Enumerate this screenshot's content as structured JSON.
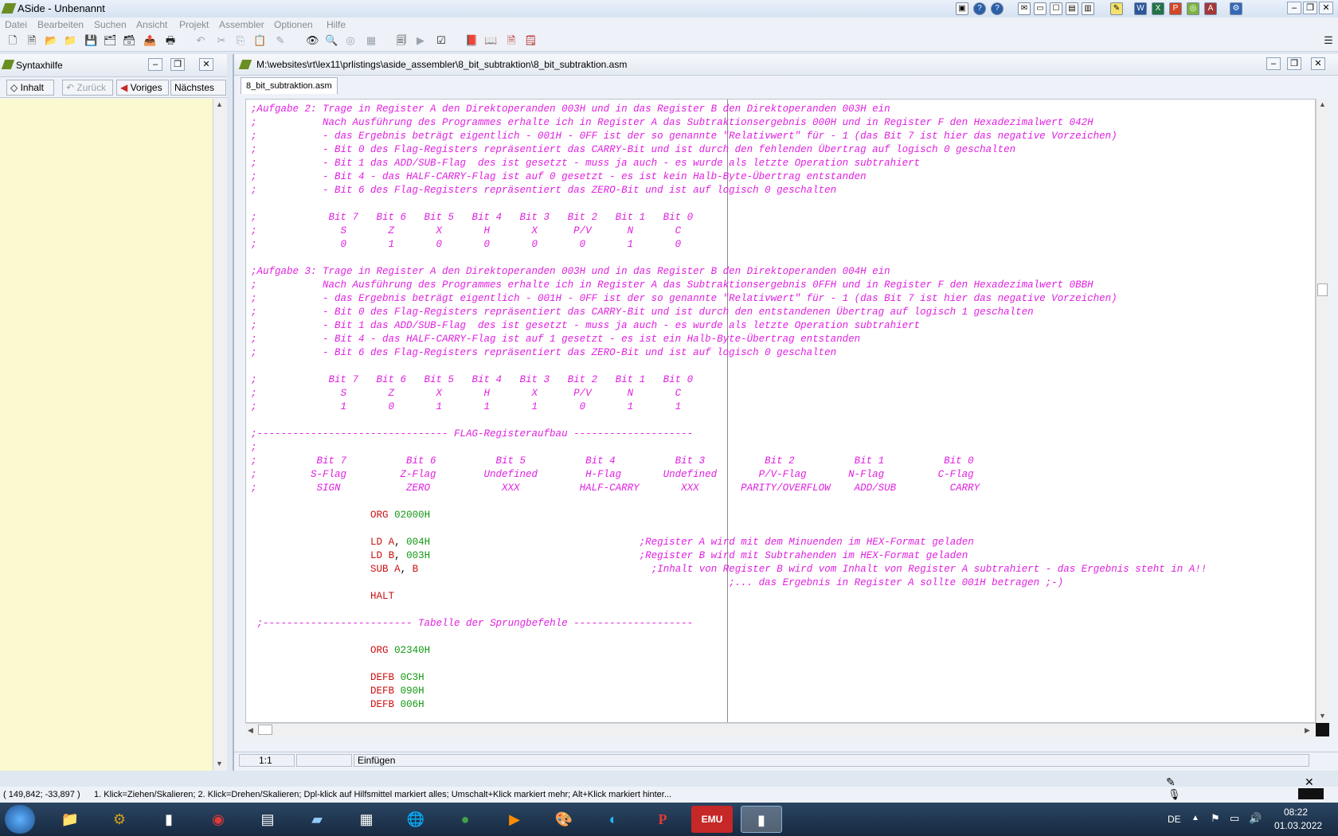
{
  "app": {
    "title": "ASide - Unbenannt"
  },
  "menu": [
    "Datei",
    "Bearbeiten",
    "Suchen",
    "Ansicht",
    "Projekt",
    "Assembler",
    "Optionen",
    "Hilfe"
  ],
  "left_panel": {
    "title": "Syntaxhilfe",
    "btn_inhalt": "Inhalt",
    "btn_zurueck": "Zurück",
    "btn_voriges": "Voriges",
    "btn_naechstes": "Nächstes"
  },
  "editor": {
    "title": "M:\\websites\\rt\\lex11\\prlistings\\aside_assembler\\8_bit_subtraktion\\8_bit_subtraktion.asm",
    "tab": "8_bit_subtraktion.asm",
    "status_pos": "1:1",
    "status_mode": "Einfügen",
    "code_lines": [
      ";Aufgabe 2: Trage in Register A den Direktoperanden 003H und in das Register B den Direktoperanden 003H ein",
      ";           Nach Ausführung des Programmes erhalte ich in Register A das Subtraktionsergebnis 000H und in Register F den Hexadezimalwert 042H",
      ";           - das Ergebnis beträgt eigentlich - 001H - 0FF ist der so genannte \"Relativwert\" für - 1 (das Bit 7 ist hier das negative Vorzeichen)",
      ";           - Bit 0 des Flag-Registers repräsentiert das CARRY-Bit und ist durch den fehlenden Übertrag auf logisch 0 geschalten",
      ";           - Bit 1 das ADD/SUB-Flag  des ist gesetzt - muss ja auch - es wurde als letzte Operation subtrahiert",
      ";           - Bit 4 - das HALF-CARRY-Flag ist auf 0 gesetzt - es ist kein Halb-Byte-Übertrag entstanden",
      ";           - Bit 6 des Flag-Registers repräsentiert das ZERO-Bit und ist auf logisch 0 geschalten",
      "",
      ";            Bit 7   Bit 6   Bit 5   Bit 4   Bit 3   Bit 2   Bit 1   Bit 0",
      ";              S       Z       X       H       X      P/V      N       C",
      ";              0       1       0       0       0       0       1       0",
      "",
      ";Aufgabe 3: Trage in Register A den Direktoperanden 003H und in das Register B den Direktoperanden 004H ein",
      ";           Nach Ausführung des Programmes erhalte ich in Register A das Subtraktionsergebnis 0FFH und in Register F den Hexadezimalwert 0BBH",
      ";           - das Ergebnis beträgt eigentlich - 001H - 0FF ist der so genannte \"Relativwert\" für - 1 (das Bit 7 ist hier das negative Vorzeichen)",
      ";           - Bit 0 des Flag-Registers repräsentiert das CARRY-Bit und ist durch den entstandenen Übertrag auf logisch 1 geschalten",
      ";           - Bit 1 das ADD/SUB-Flag  des ist gesetzt - muss ja auch - es wurde als letzte Operation subtrahiert",
      ";           - Bit 4 - das HALF-CARRY-Flag ist auf 1 gesetzt - es ist ein Halb-Byte-Übertrag entstanden",
      ";           - Bit 6 des Flag-Registers repräsentiert das ZERO-Bit und ist auf logisch 0 geschalten",
      "",
      ";            Bit 7   Bit 6   Bit 5   Bit 4   Bit 3   Bit 2   Bit 1   Bit 0",
      ";              S       Z       X       H       X      P/V      N       C",
      ";              1       0       1       1       1       0       1       1",
      "",
      ";-------------------------------- FLAG-Registeraufbau --------------------",
      ";",
      ";          Bit 7          Bit 6          Bit 5          Bit 4          Bit 3          Bit 2          Bit 1          Bit 0",
      ";         S-Flag         Z-Flag        Undefined        H-Flag       Undefined       P/V-Flag       N-Flag         C-Flag",
      ";          SIGN           ZERO            XXX          HALF-CARRY       XXX       PARITY/OVERFLOW    ADD/SUB         CARRY"
    ],
    "asm": {
      "org1": "02000H",
      "ld_a_val": "004H",
      "ld_b_val": "003H",
      "comment_ld_a": ";Register A wird mit dem Minuenden im HEX-Format geladen",
      "comment_ld_b": ";Register B wird mit Subtrahenden im HEX-Format geladen",
      "comment_sub": ";Inhalt von Register B wird vom Inhalt von Register A subtrahiert - das Ergebnis steht in A!!",
      "comment_result": ";... das Ergebnis in Register A sollte 001H betragen ;-)",
      "table_header": ";------------------------- Tabelle der Sprungbefehle --------------------",
      "org2": "02340H",
      "defb1": "0C3H",
      "defb2": "090H",
      "defb3": "006H"
    }
  },
  "statusbar": {
    "coords": "( 149,842; -33,897 )",
    "hint": "1. Klick=Ziehen/Skalieren; 2. Klick=Drehen/Skalieren; Dpl-klick auf Hilfsmittel markiert alles; Umschalt+Klick markiert mehr; Alt+Klick markiert hinter..."
  },
  "taskbar": {
    "lang": "DE",
    "time": "08:22",
    "date": "01.03.2022"
  }
}
